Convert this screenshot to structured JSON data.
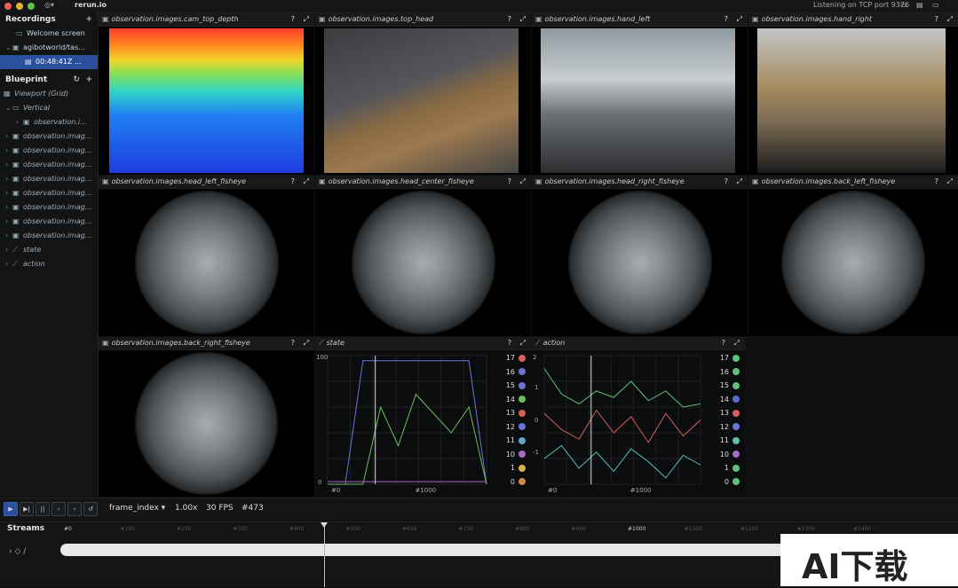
{
  "app": {
    "title": "rerun.io",
    "status": "Listening on TCP port 9376"
  },
  "recordings": {
    "header": "Recordings",
    "items": [
      {
        "label": "Welcome screen"
      },
      {
        "label": "agibotworld/tas..."
      },
      {
        "label": "00:48:41Z ..."
      }
    ]
  },
  "blueprint": {
    "header": "Blueprint",
    "viewport_label": "Viewport (Grid)",
    "vertical_label": "Vertical",
    "child_label": "observation.i...",
    "items": [
      "observation.imag...",
      "observation.imag...",
      "observation.imag...",
      "observation.imag...",
      "observation.imag...",
      "observation.imag...",
      "observation.imag...",
      "observation.imag..."
    ],
    "state_label": "state",
    "action_label": "action"
  },
  "views": [
    {
      "title": "observation.images.cam_top_depth"
    },
    {
      "title": "observation.images.top_head"
    },
    {
      "title": "observation.images.hand_left"
    },
    {
      "title": "observation.images.hand_right"
    },
    {
      "title": "observation.images.head_left_fisheye"
    },
    {
      "title": "observation.images.head_center_fisheye"
    },
    {
      "title": "observation.images.head_right_fisheye"
    },
    {
      "title": "observation.images.back_left_fisheye"
    },
    {
      "title": "observation.images.back_right_fisheye"
    }
  ],
  "plots": {
    "state": {
      "title": "state",
      "y_top": "100",
      "y_bottom": "0",
      "x_left": "#0",
      "x_right": "#1000"
    },
    "action": {
      "title": "action",
      "y_top": "2",
      "y_mid1": "1",
      "y_mid0": "0",
      "y_neg": "-1",
      "x_left": "#0",
      "x_right": "#1000"
    },
    "legend": [
      "17",
      "16",
      "15",
      "14",
      "13",
      "12",
      "11",
      "10",
      "1",
      "0"
    ],
    "state_colors": [
      "#d9605a",
      "#6c73d8",
      "#6c73d8",
      "#6abf5a",
      "#d9605a",
      "#6c73d8",
      "#5aa7c8",
      "#a869c9",
      "#d4b54d",
      "#d08a4a"
    ],
    "action_colors": [
      "#5fc07a",
      "#5fc07a",
      "#5fc07a",
      "#5a6ad0",
      "#d9605a",
      "#6c73d8",
      "#5ac0b0",
      "#a869c9",
      "#5fc07a",
      "#5fc07a"
    ]
  },
  "chart_data": [
    {
      "type": "line",
      "title": "state",
      "ylim": [
        0,
        100
      ],
      "series": [
        {
          "name": "16",
          "values": [
            0,
            0,
            96,
            96,
            96,
            96,
            96,
            96,
            96,
            0
          ]
        },
        {
          "name": "14",
          "values": [
            0,
            0,
            0,
            60,
            30,
            70,
            55,
            40,
            60,
            0
          ]
        },
        {
          "name": "10",
          "values": [
            2,
            2,
            2,
            2,
            2,
            2,
            2,
            2,
            2,
            2
          ]
        }
      ]
    },
    {
      "type": "line",
      "title": "action",
      "ylim": [
        -2,
        2
      ],
      "series": [
        {
          "name": "15",
          "values": [
            1.6,
            0.8,
            0.5,
            0.9,
            0.7,
            1.2,
            0.6,
            0.9,
            0.4,
            0.5
          ]
        },
        {
          "name": "13",
          "values": [
            0.2,
            -0.3,
            -0.6,
            0.3,
            -0.4,
            0.1,
            -0.7,
            0.2,
            -0.5,
            0.0
          ]
        },
        {
          "name": "11",
          "values": [
            -1.2,
            -0.8,
            -1.5,
            -1.0,
            -1.6,
            -0.9,
            -1.3,
            -1.8,
            -1.1,
            -1.4
          ]
        }
      ]
    }
  ],
  "playback": {
    "timeline": "frame_index",
    "speed": "1.00x",
    "fps": "30 FPS",
    "frame": "#473"
  },
  "streams": {
    "header": "Streams",
    "root": "/",
    "ticks": [
      "#0",
      "#100",
      "#200",
      "#300",
      "#400",
      "#500",
      "#600",
      "#700",
      "#800",
      "#900",
      "#1000",
      "#1100",
      "#1200",
      "#1300",
      "#1400"
    ]
  },
  "watermark": {
    "text": "AI下载"
  }
}
